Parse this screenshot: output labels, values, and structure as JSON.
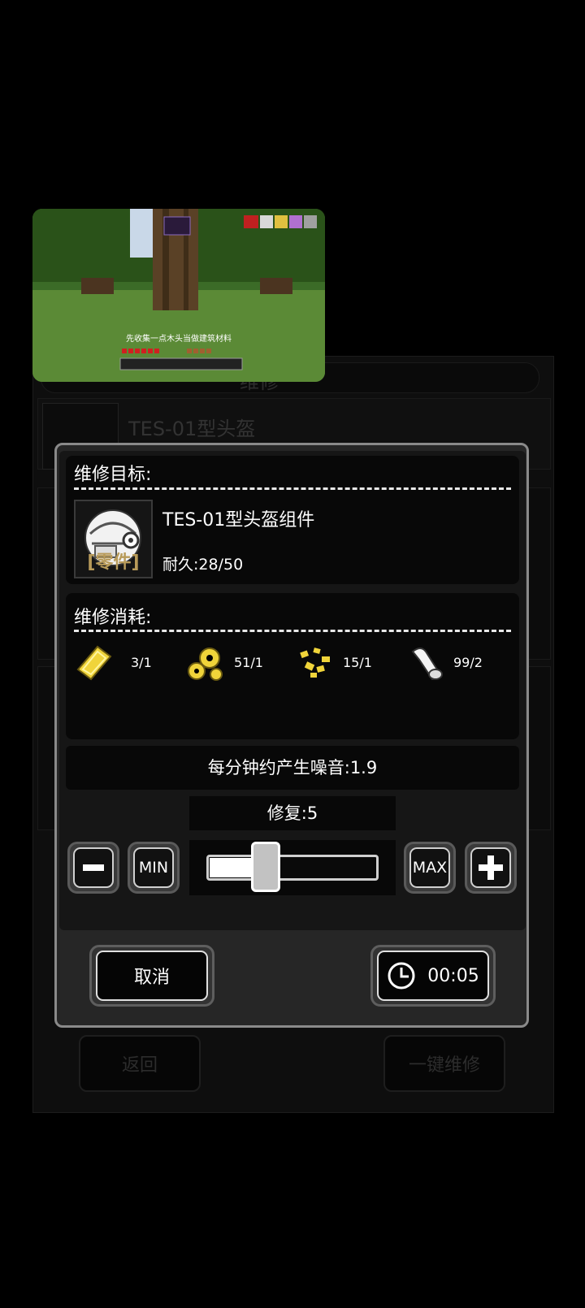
{
  "background_screen": {
    "title": "维修",
    "item_name": "TES-01型头盔",
    "back_button": "返回",
    "repair_all_button": "一键维修"
  },
  "video_overlay": {
    "subtitle": "先收集一点木头当做建筑材料"
  },
  "dialog": {
    "target_section_label": "维修目标:",
    "item": {
      "name": "TES-01型头盔组件",
      "durability": "耐久:28/50",
      "tag": "零件",
      "icon": "helmet-icon"
    },
    "cost_section_label": "维修消耗:",
    "costs": [
      {
        "icon": "card-icon",
        "value": "3/1"
      },
      {
        "icon": "gears-icon",
        "value": "51/1"
      },
      {
        "icon": "nuggets-icon",
        "value": "15/1"
      },
      {
        "icon": "scroll-icon",
        "value": "99/2"
      }
    ],
    "noise_text": "每分钟约产生噪音:1.9",
    "repair_label": "修复:5",
    "slider_level": 0.25,
    "min_label": "MIN",
    "max_label": "MAX",
    "cancel_label": "取消",
    "timer_text": "00:05"
  },
  "colors": {
    "dialog_border": "#8a8a8a",
    "section_bg": "#080808",
    "cost_icon_yellow": "#f0d43a"
  }
}
